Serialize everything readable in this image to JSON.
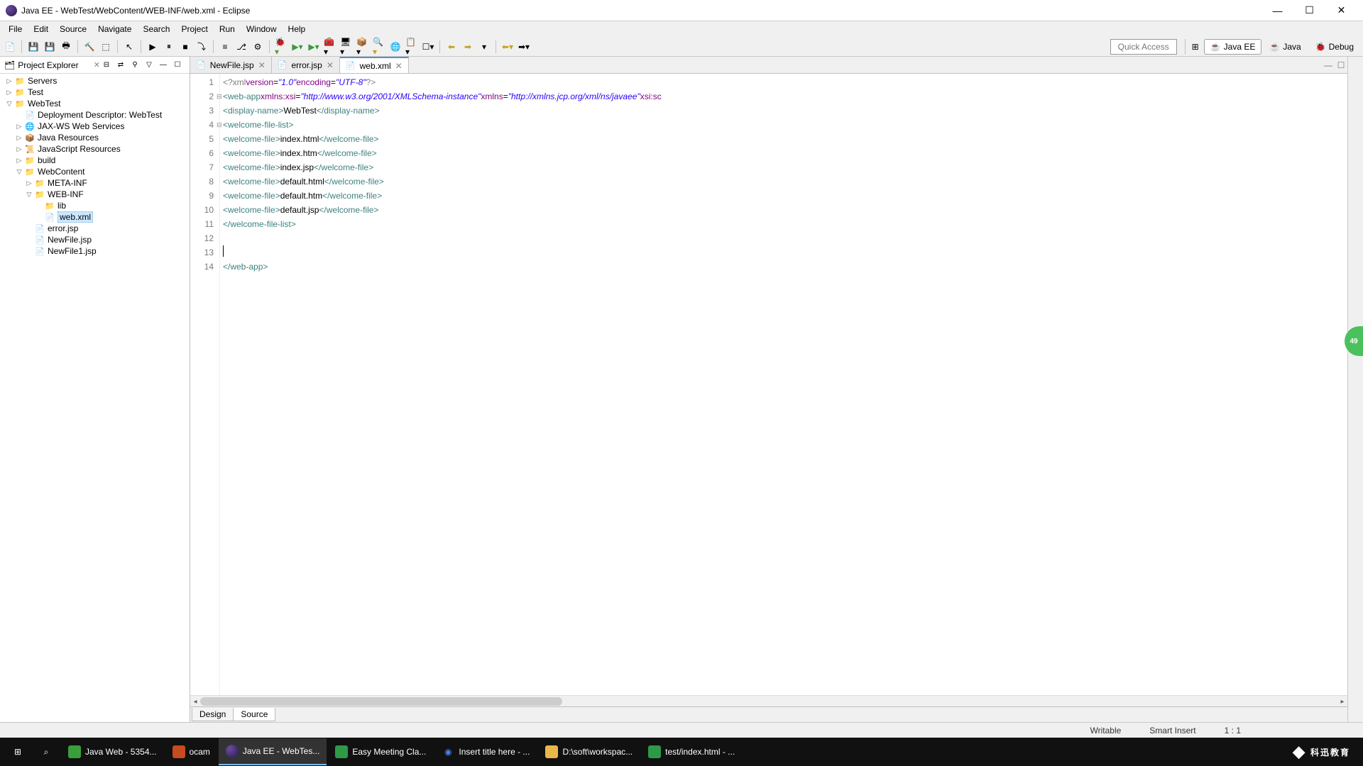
{
  "window": {
    "title": "Java EE - WebTest/WebContent/WEB-INF/web.xml - Eclipse"
  },
  "menus": [
    "File",
    "Edit",
    "Source",
    "Navigate",
    "Search",
    "Project",
    "Run",
    "Window",
    "Help"
  ],
  "quickaccess": "Quick Access",
  "perspectives": {
    "javaee": "Java EE",
    "java": "Java",
    "debug": "Debug"
  },
  "explorer": {
    "title": "Project Explorer",
    "nodes": [
      {
        "level": 0,
        "arrow": "▷",
        "icon": "folder",
        "label": "Servers"
      },
      {
        "level": 0,
        "arrow": "▷",
        "icon": "folder",
        "label": "Test"
      },
      {
        "level": 0,
        "arrow": "▽",
        "icon": "folder",
        "label": "WebTest"
      },
      {
        "level": 1,
        "arrow": "",
        "icon": "desc",
        "label": "Deployment Descriptor: WebTest"
      },
      {
        "level": 1,
        "arrow": "▷",
        "icon": "ws",
        "label": "JAX-WS Web Services"
      },
      {
        "level": 1,
        "arrow": "▷",
        "icon": "pkg",
        "label": "Java Resources"
      },
      {
        "level": 1,
        "arrow": "▷",
        "icon": "js",
        "label": "JavaScript Resources"
      },
      {
        "level": 1,
        "arrow": "▷",
        "icon": "folder",
        "label": "build"
      },
      {
        "level": 1,
        "arrow": "▽",
        "icon": "folder",
        "label": "WebContent"
      },
      {
        "level": 2,
        "arrow": "▷",
        "icon": "folder",
        "label": "META-INF"
      },
      {
        "level": 2,
        "arrow": "▽",
        "icon": "folder",
        "label": "WEB-INF"
      },
      {
        "level": 3,
        "arrow": "",
        "icon": "folder",
        "label": "lib"
      },
      {
        "level": 3,
        "arrow": "",
        "icon": "xml",
        "label": "web.xml",
        "selected": true
      },
      {
        "level": 2,
        "arrow": "",
        "icon": "jsp",
        "label": "error.jsp"
      },
      {
        "level": 2,
        "arrow": "",
        "icon": "jsp",
        "label": "NewFile.jsp"
      },
      {
        "level": 2,
        "arrow": "",
        "icon": "jsp",
        "label": "NewFile1.jsp"
      }
    ]
  },
  "tabs": [
    {
      "label": "NewFile.jsp",
      "active": false
    },
    {
      "label": "error.jsp",
      "active": false
    },
    {
      "label": "web.xml",
      "active": true
    }
  ],
  "code": {
    "lines": [
      {
        "n": 1,
        "fold": "",
        "html": "<span class='pi'>&lt;?xml</span> <span class='attr'>version</span><span class='txt'>=</span><span class='str'>\"1.0\"</span> <span class='attr'>encoding</span><span class='txt'>=</span><span class='str'>\"UTF-8\"</span><span class='pi'>?&gt;</span>"
      },
      {
        "n": 2,
        "fold": "⊟",
        "html": "<span class='tag'>&lt;web-app</span> <span class='attr'>xmlns:xsi</span><span class='txt'>=</span><span class='str'>\"http://www.w3.org/2001/XMLSchema-instance\"</span> <span class='attr'>xmlns</span><span class='txt'>=</span><span class='str'>\"http://xmlns.jcp.org/xml/ns/javaee\"</span> <span class='attr'>xsi:sc</span>"
      },
      {
        "n": 3,
        "fold": "",
        "html": "  <span class='tag'>&lt;display-name&gt;</span><span class='txt'>WebTest</span><span class='tag'>&lt;/display-name&gt;</span>"
      },
      {
        "n": 4,
        "fold": "⊟",
        "html": "  <span class='tag'>&lt;welcome-file-list&gt;</span>"
      },
      {
        "n": 5,
        "fold": "",
        "html": "    <span class='tag'>&lt;welcome-file&gt;</span><span class='txt'>index.html</span><span class='tag'>&lt;/welcome-file&gt;</span>"
      },
      {
        "n": 6,
        "fold": "",
        "html": "    <span class='tag'>&lt;welcome-file&gt;</span><span class='txt'>index.htm</span><span class='tag'>&lt;/welcome-file&gt;</span>"
      },
      {
        "n": 7,
        "fold": "",
        "html": "    <span class='tag'>&lt;welcome-file&gt;</span><span class='txt'>index.jsp</span><span class='tag'>&lt;/welcome-file&gt;</span>"
      },
      {
        "n": 8,
        "fold": "",
        "html": "    <span class='tag'>&lt;welcome-file&gt;</span><span class='txt'>default.html</span><span class='tag'>&lt;/welcome-file&gt;</span>"
      },
      {
        "n": 9,
        "fold": "",
        "html": "    <span class='tag'>&lt;welcome-file&gt;</span><span class='txt'>default.htm</span><span class='tag'>&lt;/welcome-file&gt;</span>"
      },
      {
        "n": 10,
        "fold": "",
        "html": "    <span class='tag'>&lt;welcome-file&gt;</span><span class='txt'>default.jsp</span><span class='tag'>&lt;/welcome-file&gt;</span>"
      },
      {
        "n": 11,
        "fold": "",
        "html": "  <span class='tag'>&lt;/welcome-file-list&gt;</span>"
      },
      {
        "n": 12,
        "fold": "",
        "html": "  "
      },
      {
        "n": 13,
        "fold": "",
        "html": "  <span class='text-cursor'></span>"
      },
      {
        "n": 14,
        "fold": "",
        "html": "<span class='tag'>&lt;/web-app&gt;</span>"
      }
    ]
  },
  "bottomTabs": {
    "design": "Design",
    "source": "Source"
  },
  "status": {
    "writable": "Writable",
    "insert": "Smart Insert",
    "pos": "1 : 1"
  },
  "taskbar": [
    {
      "icon": "win",
      "label": ""
    },
    {
      "icon": "search",
      "label": ""
    },
    {
      "icon": "app",
      "label": "Java Web - 5354...",
      "active": false,
      "color": "#3b9e3b"
    },
    {
      "icon": "app",
      "label": "ocam",
      "active": false,
      "color": "#c84a1f"
    },
    {
      "icon": "eclipse",
      "label": "Java EE - WebTes...",
      "active": true
    },
    {
      "icon": "app",
      "label": "Easy Meeting Cla...",
      "active": false,
      "color": "#2d9a48"
    },
    {
      "icon": "chrome",
      "label": "Insert title here - ...",
      "active": false
    },
    {
      "icon": "folder",
      "label": "D:\\soft\\workspac...",
      "active": false,
      "color": "#e8b84a"
    },
    {
      "icon": "app",
      "label": "test/index.html - ...",
      "active": false,
      "color": "#2d9a48"
    }
  ],
  "brand": "科迅教育"
}
